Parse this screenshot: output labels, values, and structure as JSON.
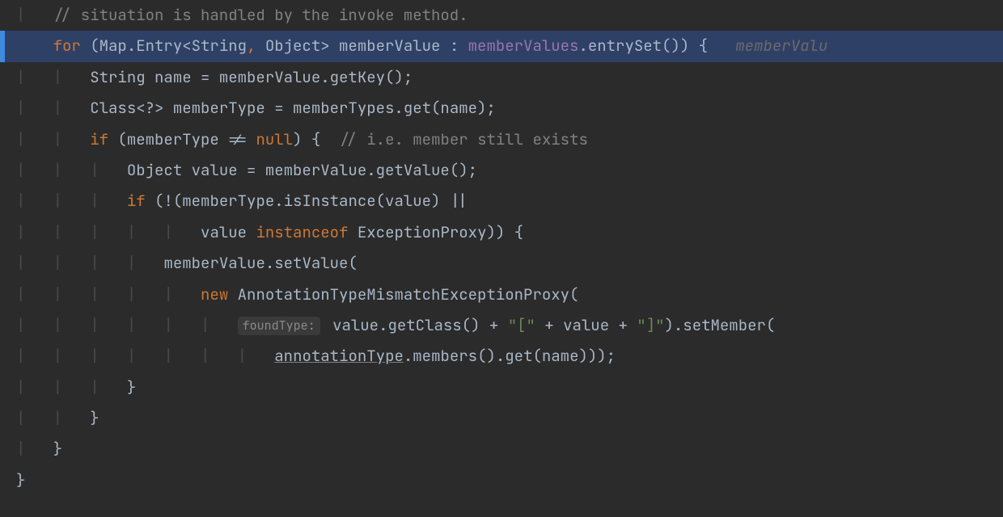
{
  "colors": {
    "bg": "#2b2b2b",
    "highlight": "#2f4066",
    "comment": "#808080",
    "keyword": "#cc7832",
    "string": "#6a8759",
    "field": "#9876aa",
    "normal": "#a9b7c6"
  },
  "inlay": {
    "foundType": "foundType:"
  },
  "lines": {
    "l0": {
      "indent2": "    ",
      "indent1": "  ",
      "c1": "// situation is handled by the invoke method."
    },
    "l1": {
      "kFor": "for",
      "p": " (Map.Entry<String",
      "comma": ", ",
      "obj": "Object> memberValue : ",
      "fld": "memberValues",
      "after": ".entrySet()) {",
      "trail": "memberValu"
    },
    "l2": {
      "t": "String name = memberValue.getKey();"
    },
    "l3": {
      "t": "Class<?> memberType = memberTypes.get(name);"
    },
    "l4": {
      "kIf": "if",
      "p1": " (memberType != ",
      "kNull": "null",
      "p2": ") {  ",
      "c": "// i.e. member still exists"
    },
    "l5": {
      "t": "Object value = memberValue.getValue();"
    },
    "l6": {
      "kIf": "if",
      "p": " (!(memberType.isInstance(value) ||"
    },
    "l7": {
      "pre": "value ",
      "kInst": "instanceof",
      "post": " ExceptionProxy)) {"
    },
    "l8": {
      "t": "memberValue.setValue("
    },
    "l9": {
      "kNew": "new",
      "post": " AnnotationTypeMismatchExceptionProxy("
    },
    "l10": {
      "p1": " value.getClass() + ",
      "s1": "\"[\"",
      "p2": " + value + ",
      "s2": "\"]\"",
      "p3": ").setMember("
    },
    "l11": {
      "u": "annotationType",
      "post": ".members().get(name)));"
    },
    "l12": {
      "t": "}"
    },
    "l13": {
      "t": "}"
    },
    "l14": {
      "t": "}"
    },
    "l15": {
      "t": "}"
    }
  }
}
